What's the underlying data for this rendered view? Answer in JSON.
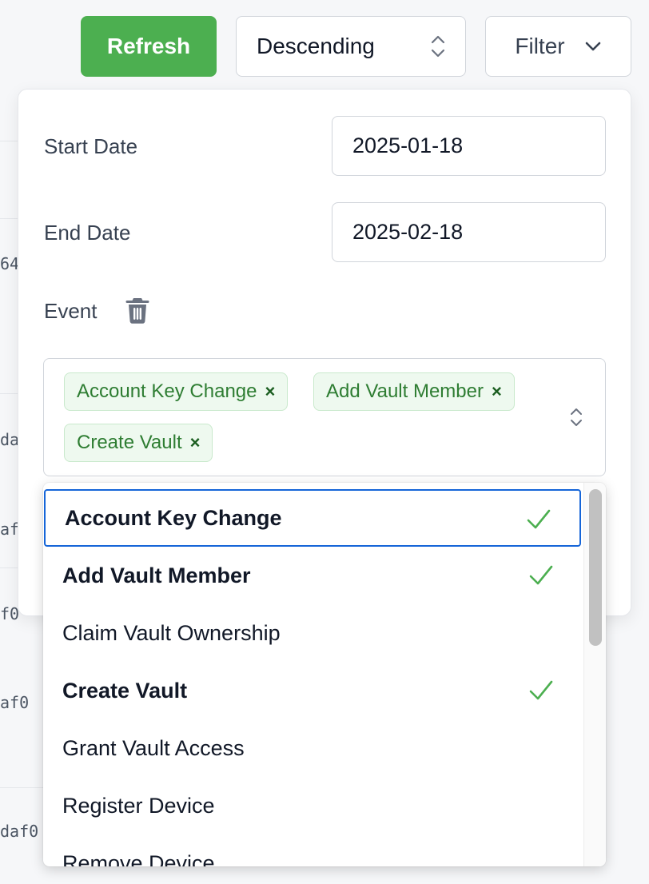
{
  "toolbar": {
    "refresh_label": "Refresh",
    "sort_value": "Descending",
    "filter_label": "Filter"
  },
  "background_rows": [
    "64",
    "da",
    "af",
    "f0",
    "af0",
    "daf0"
  ],
  "filter": {
    "start_date_label": "Start Date",
    "start_date_value": "2025-01-18",
    "end_date_label": "End Date",
    "end_date_value": "2025-02-18",
    "event_label": "Event",
    "selected_events": [
      "Account Key Change",
      "Add Vault Member",
      "Create Vault"
    ],
    "chip_remove": "×"
  },
  "event_options": [
    {
      "label": "Account Key Change",
      "selected": true
    },
    {
      "label": "Add Vault Member",
      "selected": true
    },
    {
      "label": "Claim Vault Ownership",
      "selected": false
    },
    {
      "label": "Create Vault",
      "selected": true
    },
    {
      "label": "Grant Vault Access",
      "selected": false
    },
    {
      "label": "Register Device",
      "selected": false
    },
    {
      "label": "Remove Device",
      "selected": false
    }
  ],
  "colors": {
    "accent_green": "#4caf50",
    "chip_green": "#2e7d32",
    "focus_blue": "#1565d8"
  },
  "icons": {
    "sort": "chevron-up-down-icon",
    "filter": "chevron-down-icon",
    "delete": "trash-icon",
    "selected": "check-icon"
  }
}
